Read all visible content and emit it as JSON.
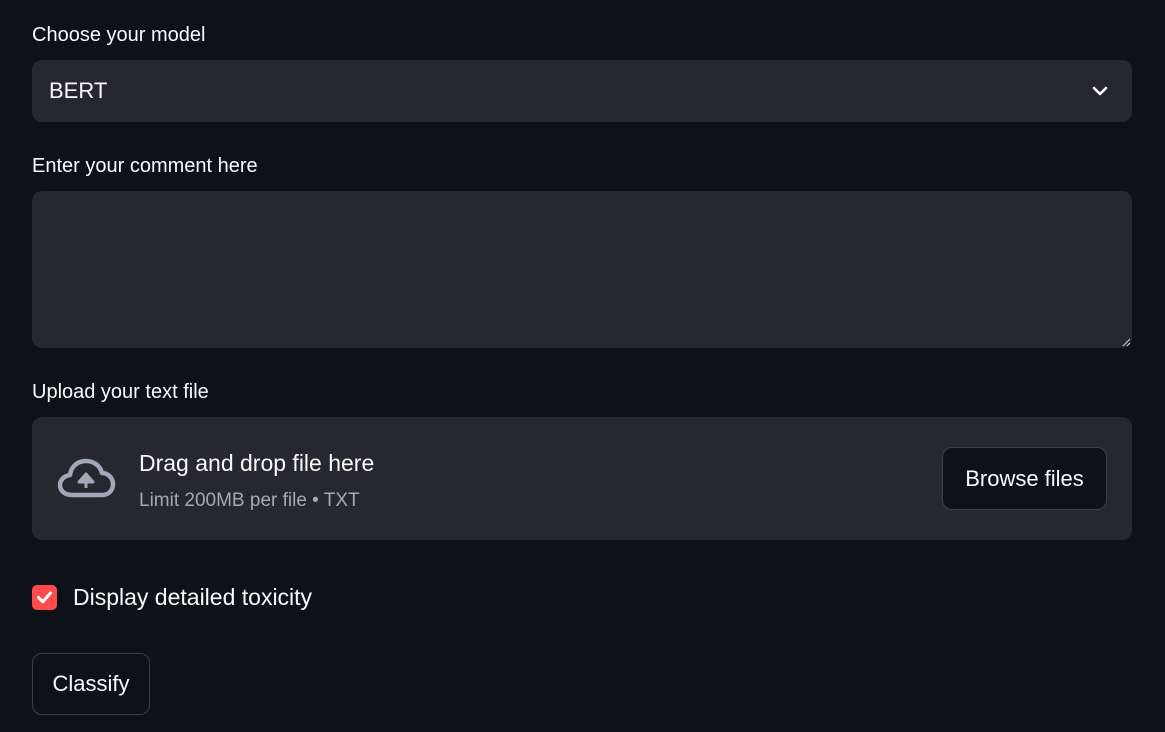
{
  "model_select": {
    "label": "Choose your model",
    "value": "BERT",
    "icon": "chevron-down-icon"
  },
  "comment": {
    "label": "Enter your comment here",
    "value": ""
  },
  "uploader": {
    "label": "Upload your text file",
    "title": "Drag and drop file here",
    "subtitle": "Limit 200MB per file • TXT",
    "browse_label": "Browse files",
    "icon": "cloud-upload-icon"
  },
  "detail_checkbox": {
    "label": "Display detailed toxicity",
    "checked": true,
    "color": "#ff4b4b"
  },
  "classify_button": {
    "label": "Classify"
  },
  "colors": {
    "background": "#0e1117",
    "input_bg": "#262730",
    "accent": "#ff4b4b"
  }
}
